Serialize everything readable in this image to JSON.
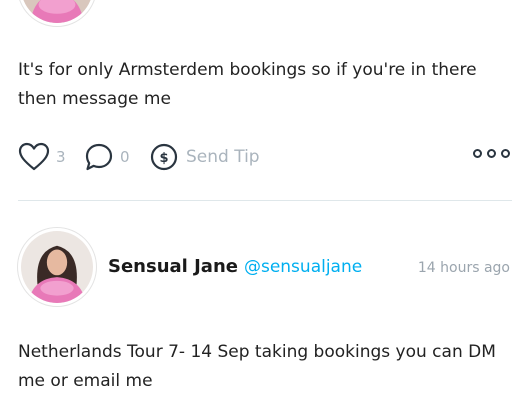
{
  "post_top": {
    "text": "It's for only Armsterdem bookings so if you're in there then message me",
    "likes": "3",
    "comments": "0",
    "send_tip_label": "Send Tip"
  },
  "post_2": {
    "author_name": "Sensual Jane",
    "author_handle": "@sensualjane",
    "timestamp": "14 hours ago",
    "text": "Netherlands Tour 7- 14 Sep taking bookings you can DM me or email me"
  },
  "icons": {
    "like": "heart-icon",
    "comment": "comment-bubble-icon",
    "tip": "dollar-circle-icon",
    "more": "more-dots-icon"
  },
  "colors": {
    "accent": "#00aff0",
    "icon": "#2a3540",
    "muted": "#aab4bd",
    "divider": "#dfe7ea"
  }
}
